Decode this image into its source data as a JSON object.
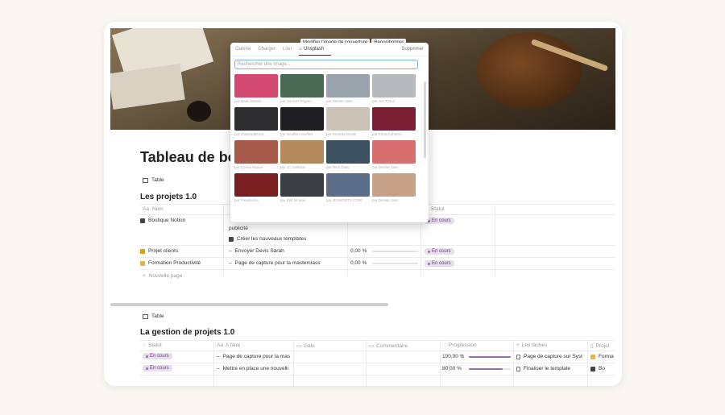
{
  "cover": {
    "buttons": [
      "Modifier l'image de couverture",
      "Repositionner"
    ]
  },
  "picker": {
    "tabs": [
      "Galerie",
      "Charger",
      "Lien",
      "Unsplash"
    ],
    "active_tab": "Unsplash",
    "delete_label": "Supprimer",
    "search_placeholder": "Rechercher une image...",
    "photos": [
      {
        "credit": "par Malte Bonon",
        "color": "#d24a72"
      },
      {
        "credit": "par Samuel Regan-...",
        "color": "#4a6a55"
      },
      {
        "credit": "par Denise Jans",
        "color": "#9aa3ab"
      },
      {
        "credit": "par Jon Tyson",
        "color": "#b7babd"
      },
      {
        "credit": "par charlesdeluvio",
        "color": "#2d2d2f"
      },
      {
        "credit": "par Geoffrey Moffett",
        "color": "#1e1e22"
      },
      {
        "credit": "par Deonda Glaski",
        "color": "#c9c2b5"
      },
      {
        "credit": "par Krists Luhaers",
        "color": "#7a2035"
      },
      {
        "credit": "par Corina Rainer",
        "color": "#a85b4a"
      },
      {
        "credit": "par JC Gellidon",
        "color": "#b48a5c"
      },
      {
        "credit": "par Tech Daily",
        "color": "#3d5161"
      },
      {
        "credit": "par Denise Jans",
        "color": "#d86f6f"
      },
      {
        "credit": "par Freestocks",
        "color": "#7a1f1f"
      },
      {
        "credit": "par Erik Mclean",
        "color": "#3b3f45"
      },
      {
        "credit": "par JESHOOTS.COM",
        "color": "#5b6f8a"
      },
      {
        "credit": "par Denise Jans",
        "color": "#c8a288"
      }
    ]
  },
  "page": {
    "title": "Tableau de bo",
    "view1": {
      "view_label": "Table",
      "heading": "Les projets 1.0",
      "col_name": "Nom",
      "col_status": "Statut",
      "rows": [
        {
          "name": "Boutique Notion",
          "tasks": [
            "publicité",
            "Créer les nouveaux templates"
          ],
          "percent": "",
          "status": "En cours"
        },
        {
          "name": "Projet clients",
          "tasks": [
            "Envoyer Devis Sarah"
          ],
          "percent": "0,00 %",
          "status": "En cours"
        },
        {
          "name": "Formation Productivité",
          "tasks": [
            "Page de capture pour la masterclass"
          ],
          "percent": "0,00 %",
          "status": "En cours"
        }
      ],
      "new_page": "Nouvelle page"
    },
    "view2": {
      "view_label": "Table",
      "heading": "La gestion de projets 1.0",
      "columns": [
        "Statut",
        "A faire",
        "Date",
        "Commentaire",
        "Progression",
        "Les tâches",
        "Projet"
      ],
      "rows": [
        {
          "status": "En cours",
          "todo": "Page de capture pour la mas",
          "progress_label": "100,00 %",
          "progress": 1.0,
          "task": "Page de capture sur Syst",
          "project": "Forma"
        },
        {
          "status": "En cours",
          "todo": "Mettre en place une nouvelli",
          "progress_label": "80,00 %",
          "progress": 0.8,
          "task": "Finaliser le template",
          "project": "Bo"
        }
      ]
    }
  }
}
